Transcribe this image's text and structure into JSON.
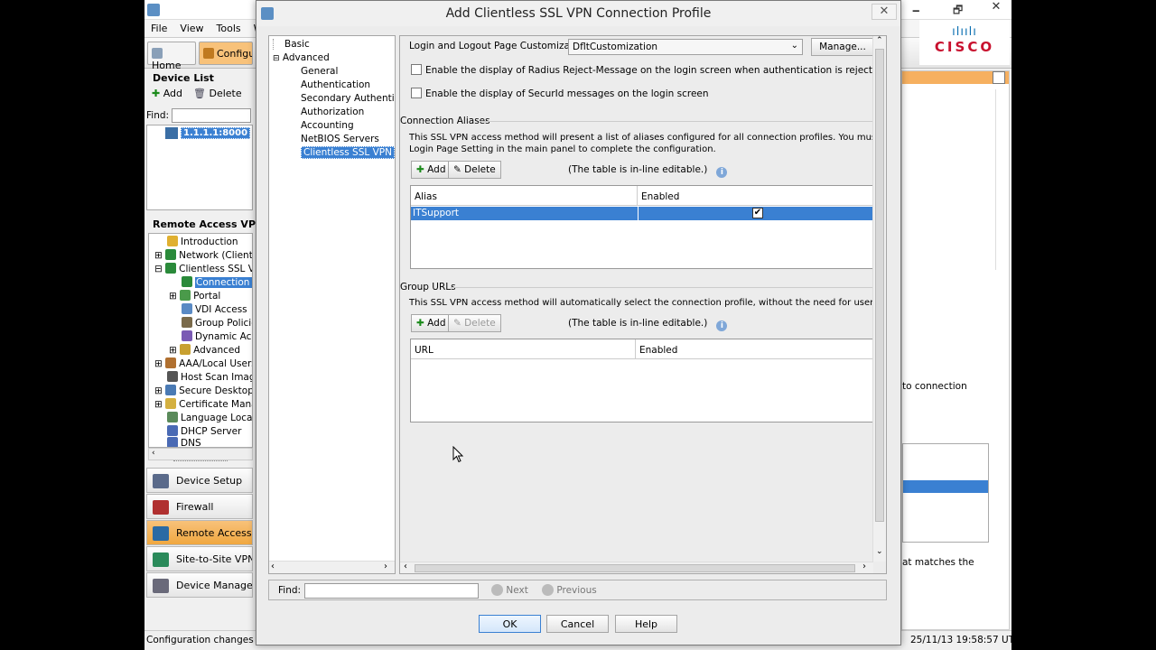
{
  "app": {
    "menu": [
      "File",
      "View",
      "Tools",
      "W"
    ],
    "toolbar": {
      "home_label": "Home",
      "config_label": "Configu"
    },
    "device_list": {
      "title": "Device List",
      "add_label": "Add",
      "delete_label": "Delete",
      "find_label": "Find:",
      "device": "1.1.1.1:8000"
    },
    "rav": {
      "title": "Remote Access VPN",
      "items": [
        "Introduction",
        "Network (Client) A",
        "Clientless SSL VPN",
        "Connection P",
        "Portal",
        "VDI Access",
        "Group Policies",
        "Dynamic Acce",
        "Advanced",
        "AAA/Local Users",
        "Host Scan Image",
        "Secure Desktop M",
        "Certificate Manag",
        "Language Localiz",
        "DHCP Server",
        "DNS"
      ]
    },
    "nav_buttons": [
      "Device Setup",
      "Firewall",
      "Remote Access VP",
      "Site-to-Site VPN",
      "Device Managemen"
    ],
    "status_left": "Configuration changes sav",
    "status_right": "25/11/13 19:58:57 UTC",
    "right_text1": "to connection",
    "right_text2": "at matches the"
  },
  "dialog": {
    "title": "Add Clientless SSL VPN Connection Profile",
    "close_label": "✕",
    "nav": {
      "basic": "Basic",
      "advanced": "Advanced",
      "children": [
        "General",
        "Authentication",
        "Secondary Authenticat",
        "Authorization",
        "Accounting",
        "NetBIOS Servers",
        "Clientless SSL VPN"
      ]
    },
    "customization_label": "Login and Logout Page Customization:",
    "customization_value": "DfltCustomization",
    "manage_label": "Manage...",
    "chk_radius": "Enable the display of Radius Reject-Message on the login screen when authentication is rejected",
    "chk_securid": "Enable the display of SecurId messages on the login screen",
    "aliases": {
      "title": "Connection Aliases",
      "desc1": "This SSL VPN access method will present a list of aliases configured for all connection profiles. You must enable the",
      "desc2": "Login Page Setting in the main panel to complete the configuration.",
      "add": "Add",
      "delete": "Delete",
      "note": "(The table is in-line editable.)",
      "col_alias": "Alias",
      "col_enabled": "Enabled",
      "row_alias": "ITSupport",
      "row_enabled_mark": "✔"
    },
    "urls": {
      "title": "Group URLs",
      "desc": "This SSL VPN access method will automatically select the connection profile, without the need for user selection.",
      "add": "Add",
      "delete": "Delete",
      "note": "(The table is in-line editable.)",
      "col_url": "URL",
      "col_enabled": "Enabled"
    },
    "find_label": "Find:",
    "next_label": "Next",
    "previous_label": "Previous",
    "ok_label": "OK",
    "cancel_label": "Cancel",
    "help_label": "Help"
  }
}
